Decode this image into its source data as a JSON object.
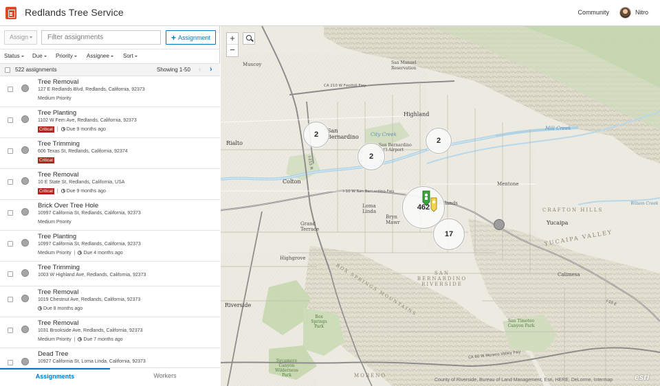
{
  "header": {
    "title": "Redlands Tree Service",
    "community_label": "Community",
    "user_name": "Nitro"
  },
  "toolbar": {
    "assign_label": "Assign",
    "filter_placeholder": "Filter assignments",
    "add_label": "Assignment"
  },
  "filters": [
    "Status",
    "Due",
    "Priority",
    "Assignee",
    "Sort"
  ],
  "list_header": {
    "count_label": "522 assignments",
    "showing_label": "Showing 1-50"
  },
  "assignments": [
    {
      "title": "Tree Removal",
      "address": "127 E Redlands Blvd, Redlands, California, 92373",
      "priority": "Medium Priority",
      "critical": "",
      "due": ""
    },
    {
      "title": "Tree Planting",
      "address": "1102 W Fern Ave, Redlands, California, 92373",
      "priority": "",
      "critical": "Critical",
      "due": "Due 9 months ago"
    },
    {
      "title": "Tree Trimming",
      "address": "606 Texas St, Redlands, California, 92374",
      "priority": "",
      "critical": "Critical",
      "due": ""
    },
    {
      "title": "Tree Removal",
      "address": "10 E State St, Redlands, California, USA",
      "priority": "",
      "critical": "Critical",
      "due": "Due 9 months ago"
    },
    {
      "title": "Brick Over Tree Hole",
      "address": "10997 California St, Redlands, California, 92373",
      "priority": "Medium Priority",
      "critical": "",
      "due": ""
    },
    {
      "title": "Tree Planting",
      "address": "10997 California St, Redlands, California, 92373",
      "priority": "Medium Priority",
      "critical": "",
      "due": "Due 4 months ago"
    },
    {
      "title": "Tree Trimming",
      "address": "1003 W Highland Ave, Redlands, California, 92373",
      "priority": "",
      "critical": "",
      "due": ""
    },
    {
      "title": "Tree Removal",
      "address": "1019 Chestnut Ave, Redlands, California, 92373",
      "priority": "",
      "critical": "",
      "due": "Due 8 months ago"
    },
    {
      "title": "Tree Removal",
      "address": "1031 Brookside Ave, Redlands, California, 92373",
      "priority": "Medium Priority",
      "critical": "",
      "due": "Due 7 months ago"
    },
    {
      "title": "Dead Tree",
      "address": "10927 California St, Loma Linda, California, 92373",
      "priority": "",
      "critical": "",
      "due": ""
    }
  ],
  "tabs": {
    "assignments": "Assignments",
    "workers": "Workers"
  },
  "map": {
    "clusters": [
      "2",
      "2",
      "2",
      "462",
      "17"
    ],
    "place_labels": {
      "muscoy": "Muscoy",
      "san_manuel": "San Manuel Reservation",
      "highland": "Highland",
      "san_bernardino": "San Bernardino",
      "rialto": "Rialto",
      "colton": "Colton",
      "mentone": "Mentone",
      "loma_linda": "Loma Linda",
      "bryn_mawr": "Bryn Mawr",
      "redlands": "Redlands",
      "grand_terrace": "Grand Terrace",
      "highgrove": "Highgrove",
      "riverside": "Riverside",
      "crafton_hills": "CRAFTON HILLS",
      "yucaipa_valley": "YUCAIPA VALLEY",
      "yucaipa": "Yucaipa",
      "calimesa": "Calimesa",
      "sb_riverside": "SAN BERNARDINO RIVERSIDE",
      "box_springs_mtns": "BOX SPRINGS MOUNTAINS",
      "box_springs_park": "Box Springs Park",
      "sycamore_canyon": "Sycamore Canyon Wilderness Park",
      "san_timoteo": "San Timoteo Canyon Park",
      "moreno": "MORENO",
      "mill_creek": "Mill Creek",
      "wilson_creek": "Wilson Creek",
      "city_creek": "City Creek",
      "airport": "San Bernardino Int'l Airport"
    },
    "road_labels": {
      "i10_w": "I-10 W San Bernardino Fwy",
      "ca210": "CA 210 W Foothill Fwy",
      "ca60": "CA 60 W Moreno Valley Fwy",
      "i215": "I-215 N",
      "i10_e": "I-10 E"
    },
    "attribution": "County of Riverside, Bureau of Land Management, Esri, HERE, DeLorme, Intermap",
    "logo": "esri"
  }
}
